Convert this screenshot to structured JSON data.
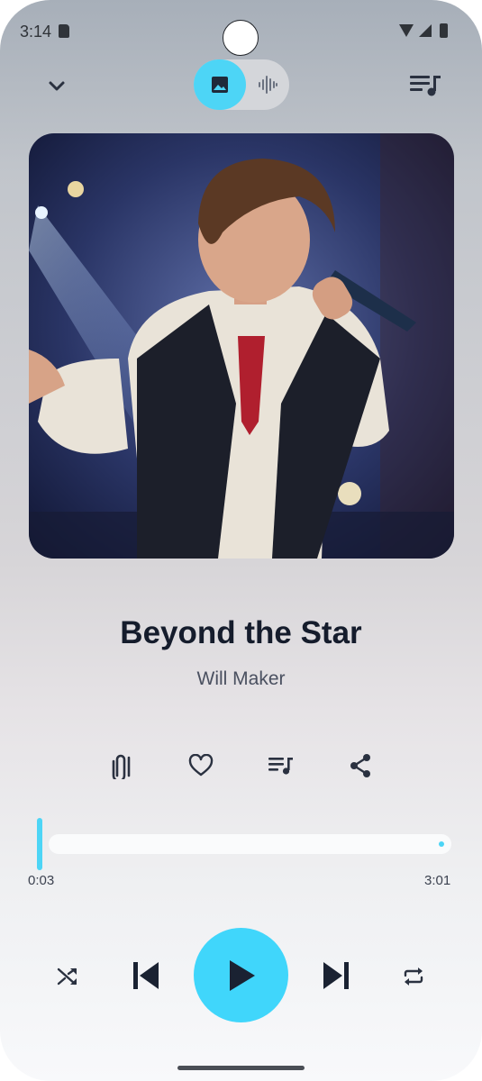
{
  "status_bar": {
    "time": "3:14"
  },
  "player": {
    "view_toggle": {
      "artwork_icon": "image-icon",
      "visualizer_icon": "waveform-icon",
      "selected": "artwork"
    },
    "track": {
      "title": "Beyond the Star",
      "artist": "Will Maker"
    },
    "actions": [
      {
        "icon": "clip-icon"
      },
      {
        "icon": "heart-icon"
      },
      {
        "icon": "playlist-icon"
      },
      {
        "icon": "share-icon"
      }
    ],
    "progress": {
      "elapsed": "0:03",
      "duration": "3:01",
      "fraction": 0.017
    },
    "controls": {
      "shuffle_icon": "shuffle-icon",
      "previous_icon": "skip-previous-icon",
      "play_icon": "play-icon",
      "next_icon": "skip-next-icon",
      "repeat_icon": "repeat-icon"
    }
  },
  "colors": {
    "accent": "#40d6fb",
    "text_primary": "#151c2c",
    "text_secondary": "#4a5060"
  }
}
